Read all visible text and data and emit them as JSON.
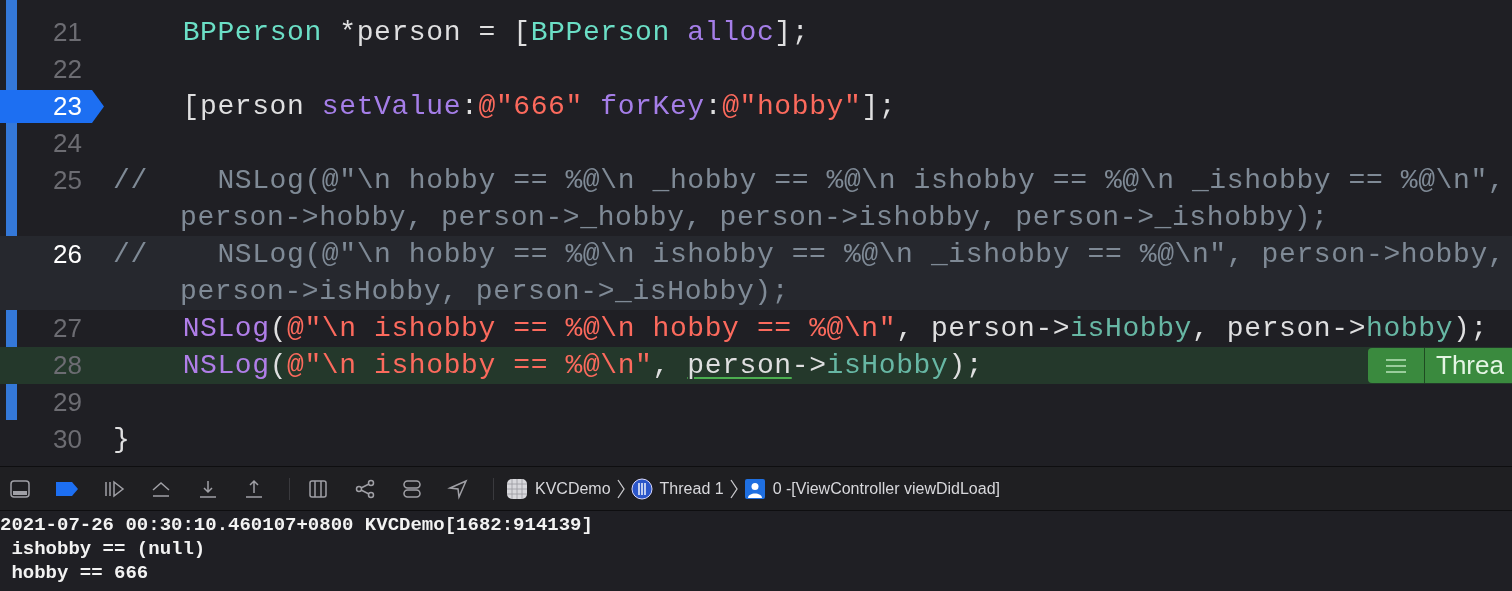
{
  "editor": {
    "lines": [
      {
        "number": "21",
        "breakpoint": false,
        "current": false,
        "stopped": false,
        "rows": [
          [
            {
              "kind": "plain",
              "text": "    "
            },
            {
              "kind": "type",
              "text": "BPPerson"
            },
            {
              "kind": "plain",
              "text": " *person = ["
            },
            {
              "kind": "type",
              "text": "BPPerson"
            },
            {
              "kind": "plain",
              "text": " "
            },
            {
              "kind": "method",
              "text": "alloc"
            },
            {
              "kind": "plain",
              "text": "];"
            }
          ]
        ]
      },
      {
        "number": "22",
        "breakpoint": false,
        "current": false,
        "stopped": false
      },
      {
        "number": "23",
        "breakpoint": true,
        "current": false,
        "stopped": false,
        "rows": [
          [
            {
              "kind": "plain",
              "text": "    [person "
            },
            {
              "kind": "method",
              "text": "setValue"
            },
            {
              "kind": "plain",
              "text": ":"
            },
            {
              "kind": "string",
              "text": "@\"666\""
            },
            {
              "kind": "plain",
              "text": " "
            },
            {
              "kind": "method",
              "text": "forKey"
            },
            {
              "kind": "plain",
              "text": ":"
            },
            {
              "kind": "string",
              "text": "@\"hobby\""
            },
            {
              "kind": "plain",
              "text": "];"
            }
          ]
        ]
      },
      {
        "number": "24",
        "breakpoint": false,
        "current": false,
        "stopped": false
      },
      {
        "number": "25",
        "breakpoint": false,
        "current": false,
        "stopped": false,
        "rows": [
          [
            {
              "kind": "comment",
              "text": "//    NSLog(@\"\\n hobby == %@\\n _hobby == %@\\n ishobby == %@\\n _ishobby == %@\\n\","
            }
          ],
          [
            {
              "kind": "comment",
              "text": "person->hobby, person->_hobby, person->ishobby, person->_ishobby);"
            }
          ]
        ]
      },
      {
        "number": "26",
        "breakpoint": false,
        "current": true,
        "stopped": false,
        "rows": [
          [
            {
              "kind": "comment",
              "text": "//    NSLog(@\"\\n hobby == %@\\n ishobby == %@\\n _ishobby == %@\\n\", person->hobby,"
            }
          ],
          [
            {
              "kind": "comment",
              "text": "person->isHobby, person->_isHobby);"
            }
          ]
        ]
      },
      {
        "number": "27",
        "breakpoint": false,
        "current": false,
        "stopped": false,
        "rows": [
          [
            {
              "kind": "plain",
              "text": "    "
            },
            {
              "kind": "function",
              "text": "NSLog"
            },
            {
              "kind": "plain",
              "text": "("
            },
            {
              "kind": "string",
              "text": "@\"\\n ishobby == %@\\n hobby == %@\\n\""
            },
            {
              "kind": "plain",
              "text": ", person->"
            },
            {
              "kind": "ivar",
              "text": "isHobby"
            },
            {
              "kind": "plain",
              "text": ", person->"
            },
            {
              "kind": "ivar",
              "text": "hobby"
            },
            {
              "kind": "plain",
              "text": ");"
            }
          ]
        ]
      },
      {
        "number": "28",
        "breakpoint": false,
        "current": false,
        "stopped": true,
        "badge": "Threa",
        "rows": [
          [
            {
              "kind": "plain",
              "text": "    "
            },
            {
              "kind": "function",
              "text": "NSLog"
            },
            {
              "kind": "plain",
              "text": "("
            },
            {
              "kind": "string",
              "text": "@\"\\n ishobby == %@\\n\""
            },
            {
              "kind": "plain",
              "text": ", "
            },
            {
              "kind": "underlined",
              "text": "person"
            },
            {
              "kind": "plain",
              "text": "->"
            },
            {
              "kind": "ivar",
              "text": "isHobby"
            },
            {
              "kind": "plain",
              "text": ");"
            }
          ]
        ]
      },
      {
        "number": "29",
        "breakpoint": false,
        "current": false,
        "stopped": false
      },
      {
        "number": "30",
        "breakpoint": false,
        "current": false,
        "stopped": false,
        "rows": [
          [
            {
              "kind": "plain",
              "text": "}"
            }
          ]
        ]
      }
    ]
  },
  "debug_bar": {
    "breakpoints_active": true,
    "breadcrumbs": [
      "KVCDemo",
      "Thread 1",
      "0 -[ViewController viewDidLoad]"
    ]
  },
  "console": {
    "lines": [
      {
        "kind": "output",
        "text": "2021-07-26 00:30:10.460107+0800 KVCDemo[1682:914139]"
      },
      {
        "kind": "output",
        "text": " ishobby == (null)"
      },
      {
        "kind": "output",
        "text": " hobby == 666"
      }
    ]
  }
}
